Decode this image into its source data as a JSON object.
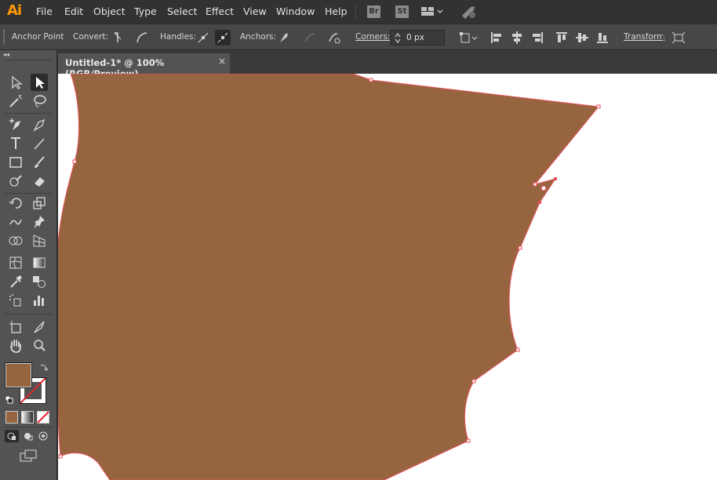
{
  "app": {
    "logo_text": "Ai",
    "accent": "#ff9a00"
  },
  "menu": {
    "items": [
      "File",
      "Edit",
      "Object",
      "Type",
      "Select",
      "Effect",
      "View",
      "Window",
      "Help"
    ],
    "bridge_label": "Br",
    "stock_label": "St"
  },
  "control_bar": {
    "anchor_point": "Anchor Point",
    "convert_label": "Convert:",
    "handles_label": "Handles:",
    "anchors_label": "Anchors:",
    "corners_label": "Corners:",
    "corners_value": "0 px",
    "transform_label": "Transform"
  },
  "document": {
    "tab_title": "Untitled-1* @ 100% (RGB/Preview)",
    "close_glyph": "×"
  },
  "colors": {
    "fill": "#966540",
    "path_stroke": "#e8505b",
    "canvas_bg": "#ffffff"
  },
  "toolbar": {
    "collapse_glyph": "◂◂"
  }
}
